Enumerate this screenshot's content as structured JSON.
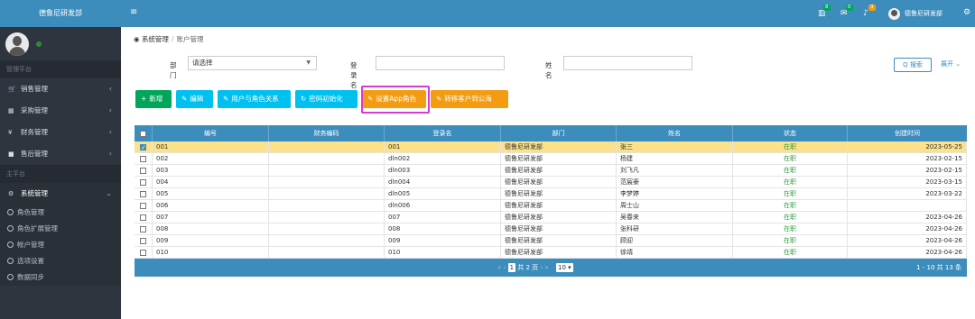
{
  "brand": "德鲁尼研发部",
  "sidebar": {
    "group1": "管理平台",
    "group2": "主平台",
    "items": [
      {
        "label": "销售管理",
        "icon": "cart-icon"
      },
      {
        "label": "采购管理",
        "icon": "grid-icon"
      },
      {
        "label": "财务管理",
        "icon": "yen-icon"
      },
      {
        "label": "售后管理",
        "icon": "briefcase-icon"
      }
    ],
    "system": {
      "label": "系统管理",
      "icon": "gears-icon"
    },
    "subitems": [
      "角色管理",
      "角色扩展管理",
      "帐户管理",
      "选项设置",
      "数据同步"
    ]
  },
  "topbar": {
    "badges": [
      "8",
      "0",
      "3"
    ],
    "user": "德鲁尼研发部"
  },
  "breadcrumb": {
    "root": "系统管理",
    "sep": "/",
    "current": "账户管理"
  },
  "filter": {
    "dept_label": "部门",
    "dept_value": "请选择",
    "login_label": "登录名",
    "name_label": "姓名",
    "search": "Q 搜索",
    "expand": "展开"
  },
  "toolbar": {
    "add": "新增",
    "edit": "编辑",
    "user_role": "用户与角色关系",
    "reset_pwd": "密码初始化",
    "set_app_role": "设置App角色",
    "transfer": "转移客户到公海"
  },
  "table": {
    "headers": [
      "编号",
      "财务编码",
      "登录名",
      "部门",
      "姓名",
      "状态",
      "创建时间"
    ],
    "rows": [
      {
        "id": "001",
        "fin": "",
        "login": "001",
        "dept": "德鲁尼研发部",
        "name": "张三",
        "status": "在职",
        "created": "2023-05-25",
        "selected": true
      },
      {
        "id": "002",
        "fin": "",
        "login": "dln002",
        "dept": "德鲁尼研发部",
        "name": "杨建",
        "status": "在职",
        "created": "2023-02-15",
        "selected": false
      },
      {
        "id": "003",
        "fin": "",
        "login": "dln003",
        "dept": "德鲁尼研发部",
        "name": "刘飞凡",
        "status": "在职",
        "created": "2023-02-15",
        "selected": false
      },
      {
        "id": "004",
        "fin": "",
        "login": "dln004",
        "dept": "德鲁尼研发部",
        "name": "范宸豪",
        "status": "在职",
        "created": "2023-03-15",
        "selected": false
      },
      {
        "id": "005",
        "fin": "",
        "login": "dln005",
        "dept": "德鲁尼研发部",
        "name": "李梦婷",
        "status": "在职",
        "created": "2023-03-22",
        "selected": false
      },
      {
        "id": "006",
        "fin": "",
        "login": "dln006",
        "dept": "德鲁尼研发部",
        "name": "周士山",
        "status": "在职",
        "created": "",
        "selected": false
      },
      {
        "id": "007",
        "fin": "",
        "login": "007",
        "dept": "德鲁尼研发部",
        "name": "吴春来",
        "status": "在职",
        "created": "2023-04-26",
        "selected": false
      },
      {
        "id": "008",
        "fin": "",
        "login": "008",
        "dept": "德鲁尼研发部",
        "name": "张科研",
        "status": "在职",
        "created": "2023-04-26",
        "selected": false
      },
      {
        "id": "009",
        "fin": "",
        "login": "009",
        "dept": "德鲁尼研发部",
        "name": "顾迎",
        "status": "在职",
        "created": "2023-04-26",
        "selected": false
      },
      {
        "id": "010",
        "fin": "",
        "login": "010",
        "dept": "德鲁尼研发部",
        "name": "徐靖",
        "status": "在职",
        "created": "2023-04-26",
        "selected": false
      }
    ]
  },
  "pager": {
    "page": "1",
    "total_pages": "共 2 页",
    "page_size": "10 ▾",
    "info": "1 - 10 共 13 条"
  },
  "colors": {
    "primary": "#3c8dbc",
    "green": "#00a65a",
    "cyan": "#00c0ef",
    "orange": "#f39c12",
    "highlight": "#d63ad6",
    "selected_row": "#fbe18a"
  }
}
